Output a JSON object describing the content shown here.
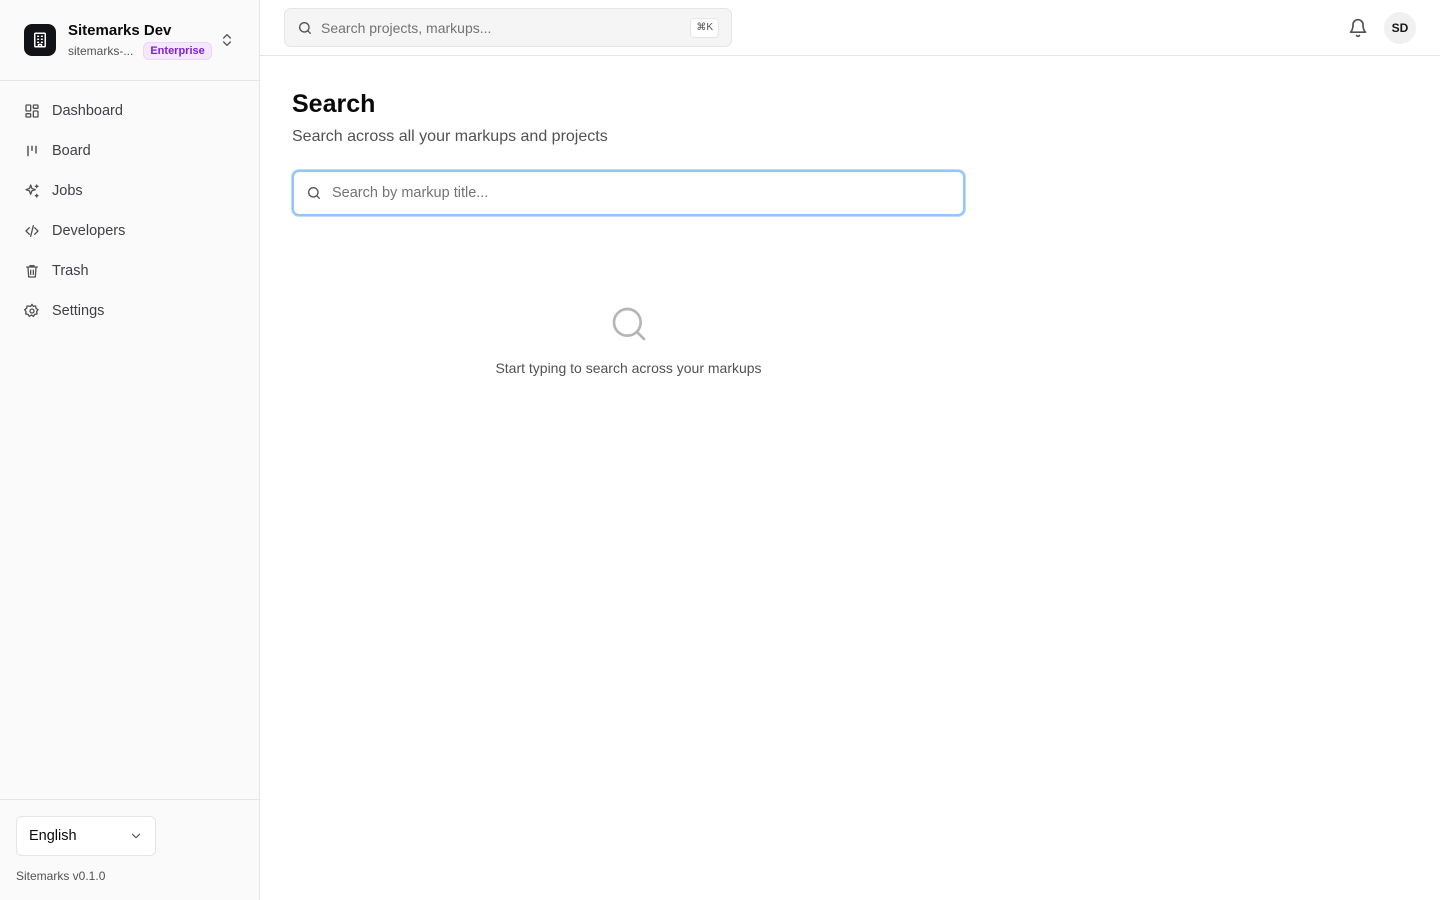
{
  "workspace": {
    "name": "Sitemarks Dev",
    "slug": "sitemarks-...",
    "plan": "Enterprise"
  },
  "sidebar": {
    "items": [
      {
        "label": "Dashboard",
        "icon": "dashboard-icon"
      },
      {
        "label": "Board",
        "icon": "board-icon"
      },
      {
        "label": "Jobs",
        "icon": "sparkles-icon"
      },
      {
        "label": "Developers",
        "icon": "code-icon"
      },
      {
        "label": "Trash",
        "icon": "trash-icon"
      },
      {
        "label": "Settings",
        "icon": "gear-icon"
      }
    ],
    "language": "English",
    "version": "Sitemarks v0.1.0"
  },
  "topbar": {
    "search_placeholder": "Search projects, markups...",
    "shortcut": "⌘K",
    "avatar_initials": "SD"
  },
  "page": {
    "title": "Search",
    "subtitle": "Search across all your markups and projects",
    "search_placeholder": "Search by markup title...",
    "empty_state": "Start typing to search across your markups"
  },
  "colors": {
    "accent_focus": "#93c5fd",
    "badge_text": "#7e22ce",
    "badge_bg": "#f3e8ff",
    "logo_bg": "#111318"
  }
}
